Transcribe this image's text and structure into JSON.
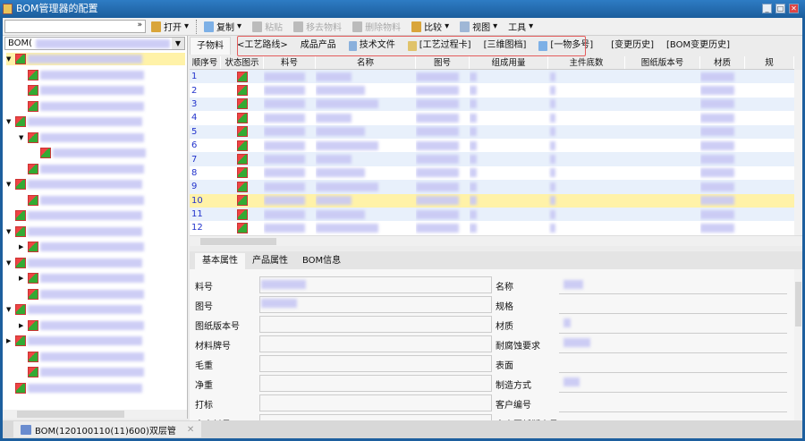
{
  "window": {
    "title": "BOM管理器的配置",
    "controls": [
      "_",
      "□",
      "✕"
    ]
  },
  "toolbar": {
    "open": "打开",
    "copy": "复制",
    "paste": "粘贴",
    "remove": "移去物料",
    "delete": "删除物料",
    "compare": "比较",
    "view": "视图",
    "tools": "工具"
  },
  "left": {
    "bom_combo": "BOM(",
    "tree_count": 19
  },
  "tabs": [
    "子物料",
    "<工艺路线>",
    "成品产品",
    "技术文件",
    "[工艺过程卡]",
    "[三维图档]",
    "[一物多号]",
    "[变更历史]",
    "[BOM变更历史]"
  ],
  "grid": {
    "columns": [
      "顺序号",
      "状态图示",
      "料号",
      "名称",
      "图号",
      "组成用量",
      "主件底数",
      "图纸版本号",
      "材质",
      "规"
    ],
    "rows": [
      "1",
      "2",
      "3",
      "4",
      "5",
      "6",
      "7",
      "8",
      "9",
      "10",
      "11",
      "12"
    ],
    "selected_row": "10"
  },
  "detail": {
    "tabs": [
      "基本属性",
      "产品属性",
      "BOM信息"
    ],
    "left_labels": [
      "料号",
      "图号",
      "图纸版本号",
      "材料牌号",
      "毛重",
      "净重",
      "打标",
      "客户料号"
    ],
    "right_labels": [
      "名称",
      "规格",
      "材质",
      "耐腐蚀要求",
      "表面",
      "制造方式",
      "客户编号",
      "客户图纸版本号"
    ]
  },
  "bottom_tab": {
    "label": "BOM(120100110(11)600)双层管",
    "close": "✕"
  },
  "colors": {
    "titlebar": "#1f6fb2",
    "highlight": "#fff2a8",
    "alt_row": "#e8f0fb",
    "redbox": "#e45c5c"
  }
}
